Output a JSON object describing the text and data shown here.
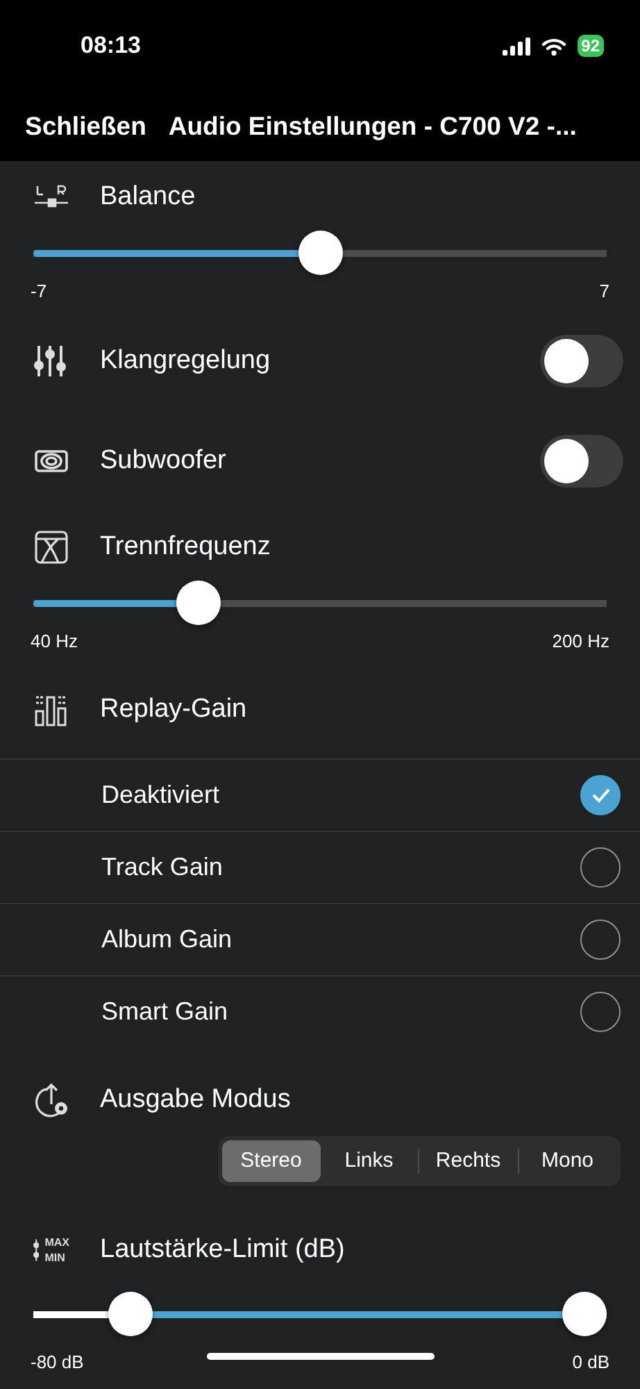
{
  "status_bar": {
    "time": "08:13",
    "battery": "92"
  },
  "nav": {
    "close": "Schließen",
    "title": "Audio Einstellungen - C700 V2 -..."
  },
  "settings": [
    {
      "kind": "slider",
      "label": "Balance",
      "level": 0.5,
      "min": "-7",
      "max": "7"
    },
    {
      "kind": "toggle",
      "label": "Klangregelung",
      "on": false
    },
    {
      "kind": "toggle",
      "label": "Subwoofer",
      "on": false
    },
    {
      "kind": "slider",
      "label": "Trennfrequenz",
      "level": 0.27,
      "min": "40 Hz",
      "max": "200 Hz"
    },
    {
      "kind": "choice",
      "label": "Replay-Gain",
      "options": [
        {
          "label": "Deaktiviert",
          "selected": true
        },
        {
          "label": "Track Gain",
          "selected": false
        },
        {
          "label": "Album Gain",
          "selected": false
        },
        {
          "label": "Smart Gain",
          "selected": false
        }
      ]
    },
    {
      "kind": "segments",
      "label": "Ausgabe Modus",
      "segments": [
        {
          "label": "Stereo",
          "selected": true
        },
        {
          "label": "Links",
          "selected": false
        },
        {
          "label": "Rechts",
          "selected": false
        },
        {
          "label": "Mono",
          "selected": false
        }
      ]
    },
    {
      "kind": "range",
      "label": "Lautstärke-Limit (dB)",
      "icon_text": [
        "MAX",
        "MIN"
      ],
      "min": "-80 dB",
      "max": "0 dB"
    }
  ]
}
